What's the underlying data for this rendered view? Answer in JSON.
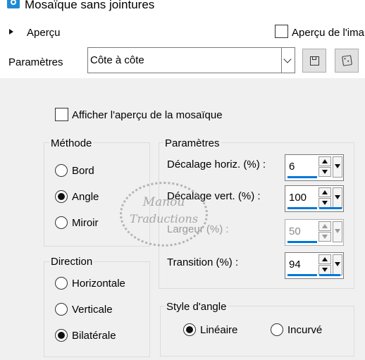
{
  "window": {
    "title": "Mosaïque sans jointures"
  },
  "preview_row": {
    "expander_label": "Aperçu",
    "checkbox_label": "Aperçu de l'ima"
  },
  "presets": {
    "label": "Paramètres",
    "selected": "Côte à côte"
  },
  "show_preview": {
    "label": "Afficher l'aperçu de la mosaïque"
  },
  "method": {
    "title": "Méthode",
    "options": [
      {
        "label": "Bord",
        "selected": false
      },
      {
        "label": "Angle",
        "selected": true
      },
      {
        "label": "Miroir",
        "selected": false
      }
    ]
  },
  "direction": {
    "title": "Direction",
    "options": [
      {
        "label": "Horizontale",
        "selected": false
      },
      {
        "label": "Verticale",
        "selected": false
      },
      {
        "label": "Bilatérale",
        "selected": true
      }
    ]
  },
  "params": {
    "title": "Paramètres",
    "fields": [
      {
        "label": "Décalage horiz. (%) :",
        "value": "6",
        "enabled": true
      },
      {
        "label": "Décalage vert. (%) :",
        "value": "100",
        "enabled": true
      },
      {
        "label": "Largeur (%) :",
        "value": "50",
        "enabled": false
      },
      {
        "label": "Transition (%) :",
        "value": "94",
        "enabled": true
      }
    ]
  },
  "angle_style": {
    "title": "Style d'angle",
    "options": [
      {
        "label": "Linéaire",
        "selected": true
      },
      {
        "label": "Incurvé",
        "selected": false
      }
    ]
  },
  "watermark": {
    "line1": "Manou",
    "line2": "Traductions"
  },
  "icons": {
    "app": "app-icon",
    "save": "save-icon",
    "randomize": "dice-icon",
    "expander": "triangle-right-icon"
  }
}
